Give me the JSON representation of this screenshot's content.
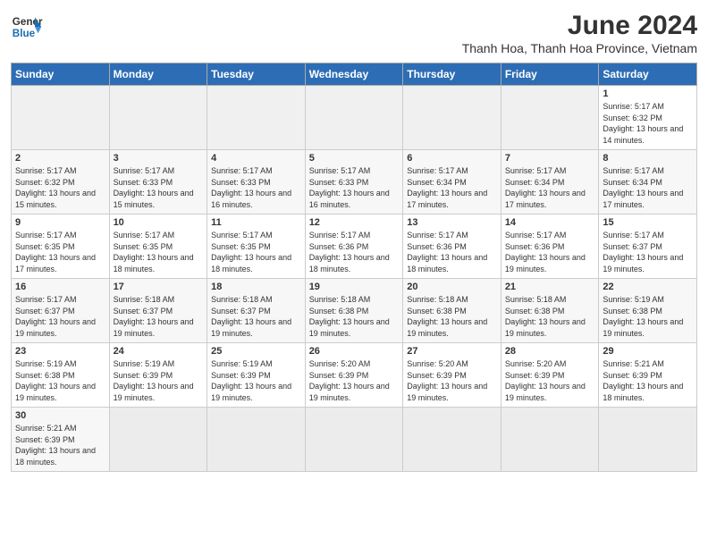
{
  "header": {
    "logo_general": "General",
    "logo_blue": "Blue",
    "month_year": "June 2024",
    "location": "Thanh Hoa, Thanh Hoa Province, Vietnam"
  },
  "weekdays": [
    "Sunday",
    "Monday",
    "Tuesday",
    "Wednesday",
    "Thursday",
    "Friday",
    "Saturday"
  ],
  "weeks": [
    [
      {
        "day": "",
        "empty": true
      },
      {
        "day": "",
        "empty": true
      },
      {
        "day": "",
        "empty": true
      },
      {
        "day": "",
        "empty": true
      },
      {
        "day": "",
        "empty": true
      },
      {
        "day": "",
        "empty": true
      },
      {
        "day": "1",
        "sunrise": "5:17 AM",
        "sunset": "6:32 PM",
        "daylight": "13 hours and 14 minutes."
      }
    ],
    [
      {
        "day": "2",
        "sunrise": "5:17 AM",
        "sunset": "6:32 PM",
        "daylight": "13 hours and 15 minutes."
      },
      {
        "day": "3",
        "sunrise": "5:17 AM",
        "sunset": "6:33 PM",
        "daylight": "13 hours and 15 minutes."
      },
      {
        "day": "4",
        "sunrise": "5:17 AM",
        "sunset": "6:33 PM",
        "daylight": "13 hours and 16 minutes."
      },
      {
        "day": "5",
        "sunrise": "5:17 AM",
        "sunset": "6:33 PM",
        "daylight": "13 hours and 16 minutes."
      },
      {
        "day": "6",
        "sunrise": "5:17 AM",
        "sunset": "6:34 PM",
        "daylight": "13 hours and 17 minutes."
      },
      {
        "day": "7",
        "sunrise": "5:17 AM",
        "sunset": "6:34 PM",
        "daylight": "13 hours and 17 minutes."
      },
      {
        "day": "8",
        "sunrise": "5:17 AM",
        "sunset": "6:34 PM",
        "daylight": "13 hours and 17 minutes."
      }
    ],
    [
      {
        "day": "9",
        "sunrise": "5:17 AM",
        "sunset": "6:35 PM",
        "daylight": "13 hours and 17 minutes."
      },
      {
        "day": "10",
        "sunrise": "5:17 AM",
        "sunset": "6:35 PM",
        "daylight": "13 hours and 18 minutes."
      },
      {
        "day": "11",
        "sunrise": "5:17 AM",
        "sunset": "6:35 PM",
        "daylight": "13 hours and 18 minutes."
      },
      {
        "day": "12",
        "sunrise": "5:17 AM",
        "sunset": "6:36 PM",
        "daylight": "13 hours and 18 minutes."
      },
      {
        "day": "13",
        "sunrise": "5:17 AM",
        "sunset": "6:36 PM",
        "daylight": "13 hours and 18 minutes."
      },
      {
        "day": "14",
        "sunrise": "5:17 AM",
        "sunset": "6:36 PM",
        "daylight": "13 hours and 19 minutes."
      },
      {
        "day": "15",
        "sunrise": "5:17 AM",
        "sunset": "6:37 PM",
        "daylight": "13 hours and 19 minutes."
      }
    ],
    [
      {
        "day": "16",
        "sunrise": "5:17 AM",
        "sunset": "6:37 PM",
        "daylight": "13 hours and 19 minutes."
      },
      {
        "day": "17",
        "sunrise": "5:18 AM",
        "sunset": "6:37 PM",
        "daylight": "13 hours and 19 minutes."
      },
      {
        "day": "18",
        "sunrise": "5:18 AM",
        "sunset": "6:37 PM",
        "daylight": "13 hours and 19 minutes."
      },
      {
        "day": "19",
        "sunrise": "5:18 AM",
        "sunset": "6:38 PM",
        "daylight": "13 hours and 19 minutes."
      },
      {
        "day": "20",
        "sunrise": "5:18 AM",
        "sunset": "6:38 PM",
        "daylight": "13 hours and 19 minutes."
      },
      {
        "day": "21",
        "sunrise": "5:18 AM",
        "sunset": "6:38 PM",
        "daylight": "13 hours and 19 minutes."
      },
      {
        "day": "22",
        "sunrise": "5:19 AM",
        "sunset": "6:38 PM",
        "daylight": "13 hours and 19 minutes."
      }
    ],
    [
      {
        "day": "23",
        "sunrise": "5:19 AM",
        "sunset": "6:38 PM",
        "daylight": "13 hours and 19 minutes."
      },
      {
        "day": "24",
        "sunrise": "5:19 AM",
        "sunset": "6:39 PM",
        "daylight": "13 hours and 19 minutes."
      },
      {
        "day": "25",
        "sunrise": "5:19 AM",
        "sunset": "6:39 PM",
        "daylight": "13 hours and 19 minutes."
      },
      {
        "day": "26",
        "sunrise": "5:20 AM",
        "sunset": "6:39 PM",
        "daylight": "13 hours and 19 minutes."
      },
      {
        "day": "27",
        "sunrise": "5:20 AM",
        "sunset": "6:39 PM",
        "daylight": "13 hours and 19 minutes."
      },
      {
        "day": "28",
        "sunrise": "5:20 AM",
        "sunset": "6:39 PM",
        "daylight": "13 hours and 19 minutes."
      },
      {
        "day": "29",
        "sunrise": "5:21 AM",
        "sunset": "6:39 PM",
        "daylight": "13 hours and 18 minutes."
      }
    ],
    [
      {
        "day": "30",
        "sunrise": "5:21 AM",
        "sunset": "6:39 PM",
        "daylight": "13 hours and 18 minutes."
      },
      {
        "day": "",
        "empty": true
      },
      {
        "day": "",
        "empty": true
      },
      {
        "day": "",
        "empty": true
      },
      {
        "day": "",
        "empty": true
      },
      {
        "day": "",
        "empty": true
      },
      {
        "day": "",
        "empty": true
      }
    ]
  ],
  "labels": {
    "sunrise": "Sunrise:",
    "sunset": "Sunset:",
    "daylight": "Daylight:"
  }
}
